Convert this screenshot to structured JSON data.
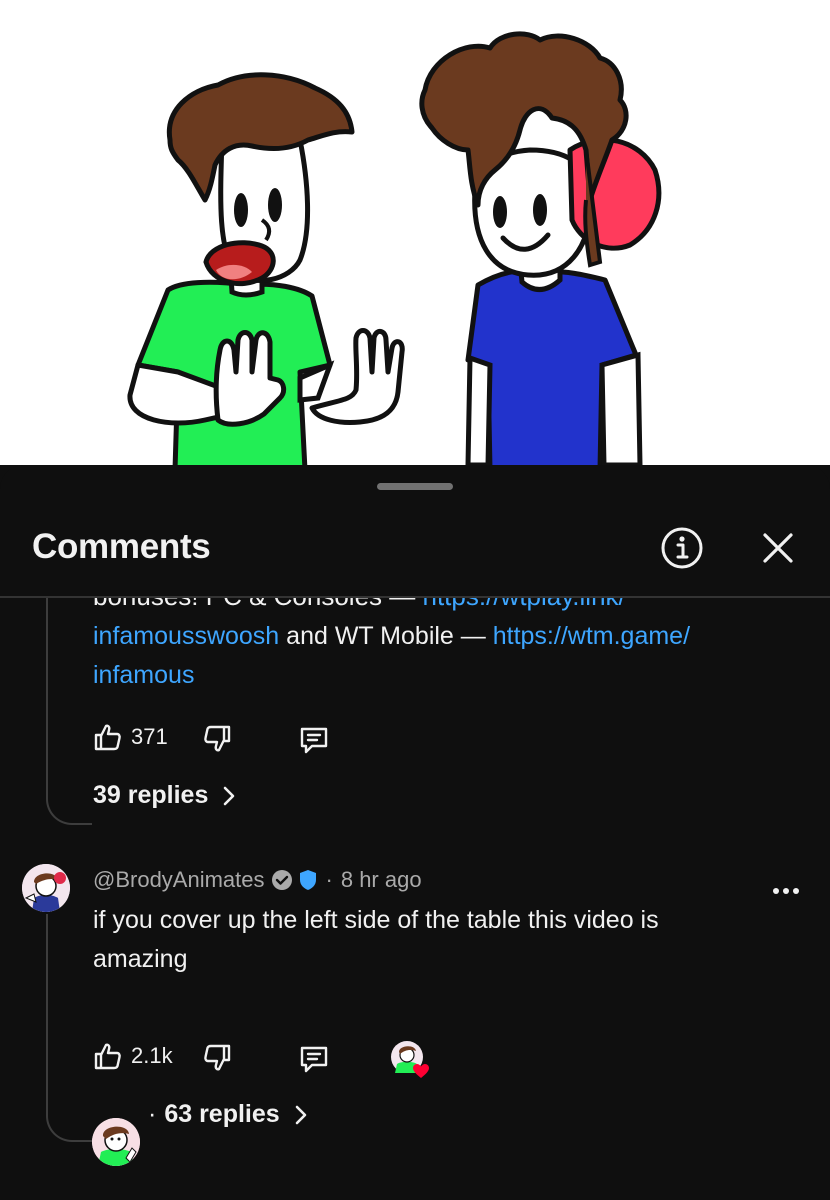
{
  "panel": {
    "title": "Comments",
    "info_icon": "info-icon",
    "close_icon": "close-icon"
  },
  "pinned_comment": {
    "cut_text": "bonuses! PC & Consoles — ",
    "cut_link": "https://wtplay.link/",
    "link1_part2": "infamousswoosh",
    "middle_text": " and WT Mobile — ",
    "link2_part1": "https://wtm.game/",
    "link2_part2": "infamous",
    "likes": "371",
    "replies": "39 replies"
  },
  "comment": {
    "author": "@BrodyAnimates",
    "separator": "·",
    "time": "8 hr ago",
    "text_line1": "if you cover up the left side of the table this video is",
    "text_line2": "amazing",
    "likes": "2.1k",
    "reply_separator": "·",
    "replies": "63 replies"
  },
  "colors": {
    "background": "#0f0f0f",
    "text": "#f1f1f1",
    "link": "#3ea6ff",
    "secondary": "#aaaaaa",
    "heart": "#ff0033",
    "green_shirt": "#22ee55",
    "blue_shirt": "#2233cc"
  }
}
